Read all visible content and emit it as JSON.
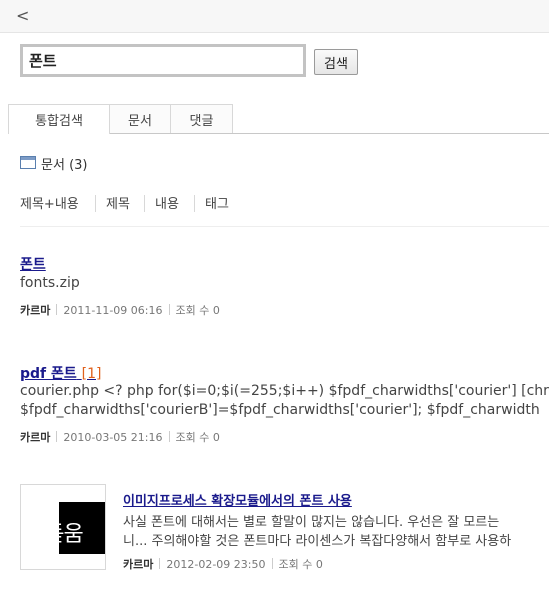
{
  "nav": {
    "back_glyph": "<"
  },
  "search": {
    "value": "폰트",
    "button_label": "검색"
  },
  "tabs": [
    {
      "label": "통합검색",
      "active": true
    },
    {
      "label": "문서",
      "active": false
    },
    {
      "label": "댓글",
      "active": false
    }
  ],
  "section": {
    "label": "문서",
    "count": "(3)"
  },
  "filters": [
    "제목+내용",
    "제목",
    "내용",
    "태그"
  ],
  "results": [
    {
      "title": "폰트",
      "count": "",
      "body": [
        "fonts.zip"
      ],
      "author": "카르마",
      "date": "2011-11-09 06:16",
      "views_label": "조회 수",
      "views": "0"
    },
    {
      "title": "pdf 폰트",
      "count": "[1]",
      "body": [
        "courier.php <? php for($i=0;$i(=255;$i++) $fpdf_charwidths['courier'] [chr($",
        "$fpdf_charwidths['courierB']=$fpdf_charwidths['courier']; $fpdf_charwidth"
      ],
      "author": "카르마",
      "date": "2010-03-05 21:16",
      "views_label": "조회 수",
      "views": "0"
    },
    {
      "title": "이미지프로세스 확장모듈에서의 폰트 사용",
      "count": "",
      "body": [
        "사실 폰트에 대해서는 별로 할말이 많지는 않습니다. 우선은 잘 모르는 ",
        "니... 주의해야할 것은 폰트마다 라이센스가 복잡다양해서 함부로 사용하"
      ],
      "author": "카르마",
      "date": "2012-02-09 23:50",
      "views_label": "조회 수",
      "views": "0",
      "thumbnail_text": "은돋움"
    }
  ]
}
